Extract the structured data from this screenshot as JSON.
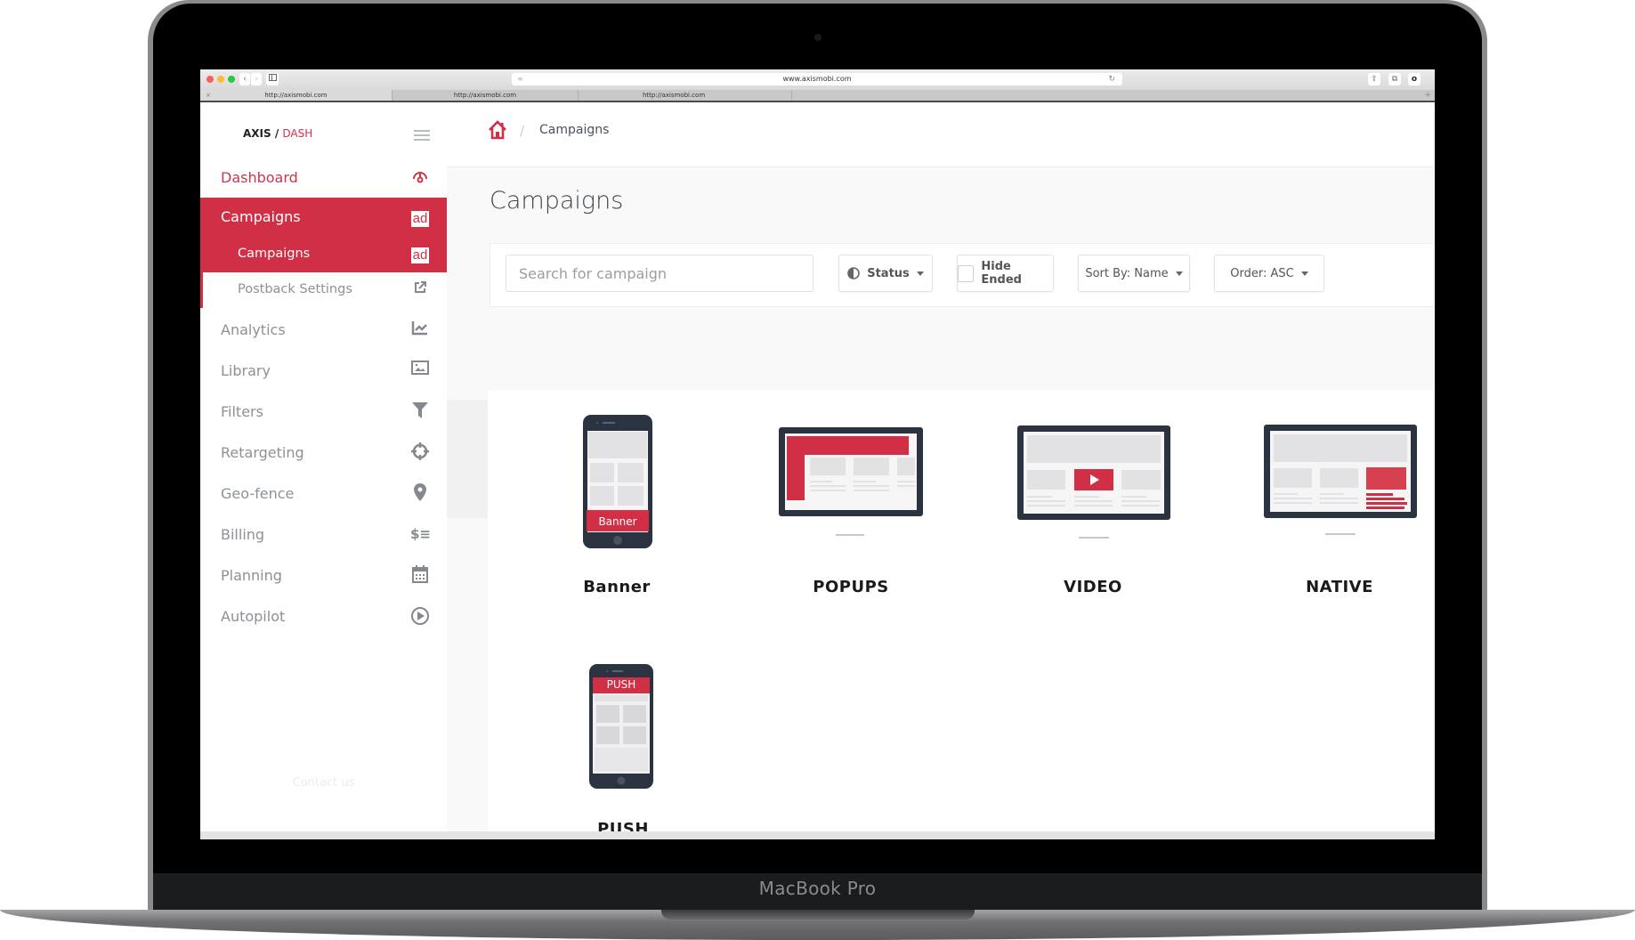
{
  "device": {
    "brand_label": "MacBook Pro"
  },
  "browser": {
    "url": "www.axismobi.com",
    "tabs": [
      {
        "label": "http://axismobi.com",
        "active": true
      },
      {
        "label": "http://axismobi.com",
        "active": false
      },
      {
        "label": "http://axismobi.com",
        "active": false
      }
    ],
    "close_glyph": "×",
    "new_tab_glyph": "+",
    "back_glyph": "‹",
    "forward_glyph": "›"
  },
  "app": {
    "logo_primary": "AXIS /",
    "logo_secondary": "DASH"
  },
  "sidebar": {
    "items": [
      {
        "label": "Dashboard",
        "icon": "gauge-icon",
        "state": "highlight"
      },
      {
        "label": "Campaigns",
        "icon": "ad-icon",
        "state": "active"
      },
      {
        "label": "Analytics",
        "icon": "chart-line-icon"
      },
      {
        "label": "Library",
        "icon": "image-icon"
      },
      {
        "label": "Filters",
        "icon": "filter-icon"
      },
      {
        "label": "Retargeting",
        "icon": "crosshair-icon"
      },
      {
        "label": "Geo-fence",
        "icon": "map-pin-icon"
      },
      {
        "label": "Billing",
        "icon": "billing-icon"
      },
      {
        "label": "Planning",
        "icon": "calendar-icon"
      },
      {
        "label": "Autopilot",
        "icon": "play-circle-icon"
      }
    ],
    "sub_items": [
      {
        "label": "Campaigns",
        "icon": "ad-icon",
        "state": "active"
      },
      {
        "label": "Postback Settings",
        "icon": "external-link-icon"
      }
    ],
    "ad_badge": "ad",
    "footer_link": "Contact us"
  },
  "header": {
    "breadcrumb_separator": "/",
    "breadcrumb_current": "Campaigns"
  },
  "main": {
    "title": "Campaigns",
    "filters": {
      "search_placeholder": "Search for campaign",
      "status_label": "Status",
      "hide_ended_label": "Hide Ended",
      "hide_ended_checked": false,
      "sort_label": "Sort By: Name",
      "order_label": "Order: ASC"
    },
    "campaign_types": [
      {
        "label": "Banner",
        "device": "phone",
        "badge": "Banner"
      },
      {
        "label": "POPUPS",
        "device": "monitor"
      },
      {
        "label": "VIDEO",
        "device": "monitor"
      },
      {
        "label": "NATIVE",
        "device": "monitor"
      },
      {
        "label": "PUSH",
        "device": "phone",
        "badge": "PUSH"
      }
    ]
  },
  "colors": {
    "accent": "#d12f45",
    "sidebar_text": "#8c9197",
    "device_frame": "#2b3240",
    "placeholder_block": "#e3e3e5"
  }
}
